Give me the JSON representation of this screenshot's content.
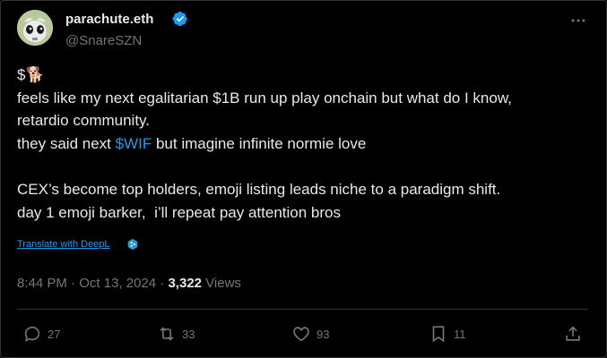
{
  "author": {
    "display_name": "parachute.eth",
    "handle": "@SnareSZN",
    "verified": true
  },
  "tweet": {
    "lines": [
      "$🐕",
      "feels like my next egalitarian $1B run up play onchain but what do I know,",
      "retardio community.",
      {
        "before": "they said next ",
        "cashtag": "$WIF",
        "after": " but imagine infinite normie love"
      },
      "",
      "CEX’s become top holders, emoji listing leads niche to a paradigm shift.",
      "day 1 emoji barker,  i’ll repeat pay attention bros"
    ],
    "translate_label": "Translate with DeepL"
  },
  "meta": {
    "time": "8:44 PM",
    "separator": "·",
    "date": "Oct 13, 2024",
    "views_count": "3,322",
    "views_label": "Views"
  },
  "actions": {
    "replies": "27",
    "reposts": "33",
    "likes": "93",
    "bookmarks": "11"
  },
  "icons": {
    "verified": "verified-badge-icon",
    "more": "more-options-icon",
    "reply": "reply-icon",
    "repost": "repost-icon",
    "like": "heart-icon",
    "bookmark": "bookmark-icon",
    "share": "share-icon",
    "deepl": "deepl-icon"
  },
  "colors": {
    "background": "#000000",
    "text": "#e7e9ea",
    "muted": "#71767b",
    "accent": "#1d9bf0",
    "border": "#2f3336"
  }
}
